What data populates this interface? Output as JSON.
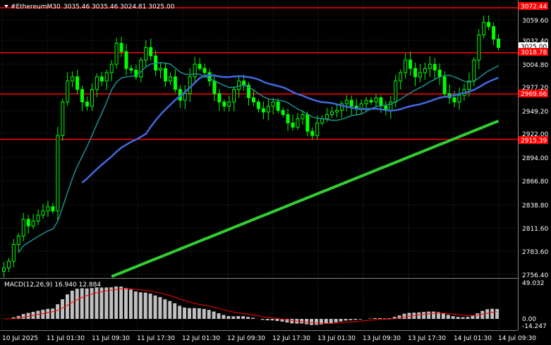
{
  "header": {
    "symbol_line": "#EthereumM30",
    "ohlc": "3035.46 3035.46 3024.81 3025.00"
  },
  "price_axis": {
    "labels": [
      "3059.60",
      "3032.40",
      "3004.80",
      "2977.20",
      "2949.20",
      "2922.00",
      "2894.00",
      "2866.80",
      "2838.80",
      "2811.60",
      "2783.60",
      "2756.40"
    ],
    "current_price": "3025.00"
  },
  "levels": [
    {
      "label": "3072.44",
      "color": "#ff0000"
    },
    {
      "label": "3018.78",
      "color": "#ff0000"
    },
    {
      "label": "2969.66",
      "color": "#ff0000"
    },
    {
      "label": "2915.39",
      "color": "#ff0000"
    }
  ],
  "macd": {
    "label": "MACD(12,26,9) 16.940 12.884",
    "scale_top": "49.032",
    "scale_zero": "0.00",
    "scale_bottom": "-14.247"
  },
  "time_axis": [
    "10 Jul 2025",
    "11 Jul 01:30",
    "11 Jul 09:30",
    "11 Jul 17:30",
    "12 Jul 01:30",
    "12 Jul 09:30",
    "12 Jul 17:30",
    "13 Jul 01:30",
    "13 Jul 09:30",
    "13 Jul 17:30",
    "14 Jul 01:30",
    "14 Jul 09:30"
  ],
  "colors": {
    "background": "#000000",
    "candles": "#00ff00",
    "level_line": "#ff0000",
    "ma_fast": "#1e8f8f",
    "ma_mid": "#4169e1",
    "ma_slow": "#32cd32",
    "macd_hist": "#c0c0c0",
    "macd_signal": "#ff0000",
    "grid": "#2e2e2e"
  },
  "chart_data": {
    "type": "candlestick",
    "y_range": [
      2750,
      3080
    ],
    "levels": [
      3072.44,
      3018.78,
      2969.66,
      2915.39
    ],
    "close_path": [
      2762,
      2770,
      2790,
      2800,
      2820,
      2812,
      2818,
      2825,
      2830,
      2835,
      2830,
      2920,
      2960,
      2985,
      2990,
      2975,
      2960,
      2955,
      2975,
      2990,
      2985,
      2995,
      3005,
      3030,
      3020,
      3000,
      2998,
      2990,
      3010,
      3025,
      3015,
      2998,
      3000,
      2985,
      2990,
      2975,
      2962,
      2970,
      2990,
      3005,
      3000,
      2995,
      2985,
      2970,
      2960,
      2955,
      2960,
      2975,
      2985,
      2980,
      2965,
      2960,
      2952,
      2948,
      2955,
      2960,
      2950,
      2945,
      2935,
      2930,
      2940,
      2945,
      2925,
      2920,
      2935,
      2940,
      2945,
      2948,
      2950,
      2958,
      2962,
      2955,
      2952,
      2958,
      2962,
      2960,
      2965,
      2955,
      2950,
      2960,
      2985,
      2995,
      3010,
      3000,
      2990,
      2995,
      3000,
      3005,
      2998,
      2990,
      2970,
      2965,
      2960,
      2968,
      2975,
      2985,
      3010,
      3040,
      3055,
      3050,
      3035,
      3025
    ]
  }
}
